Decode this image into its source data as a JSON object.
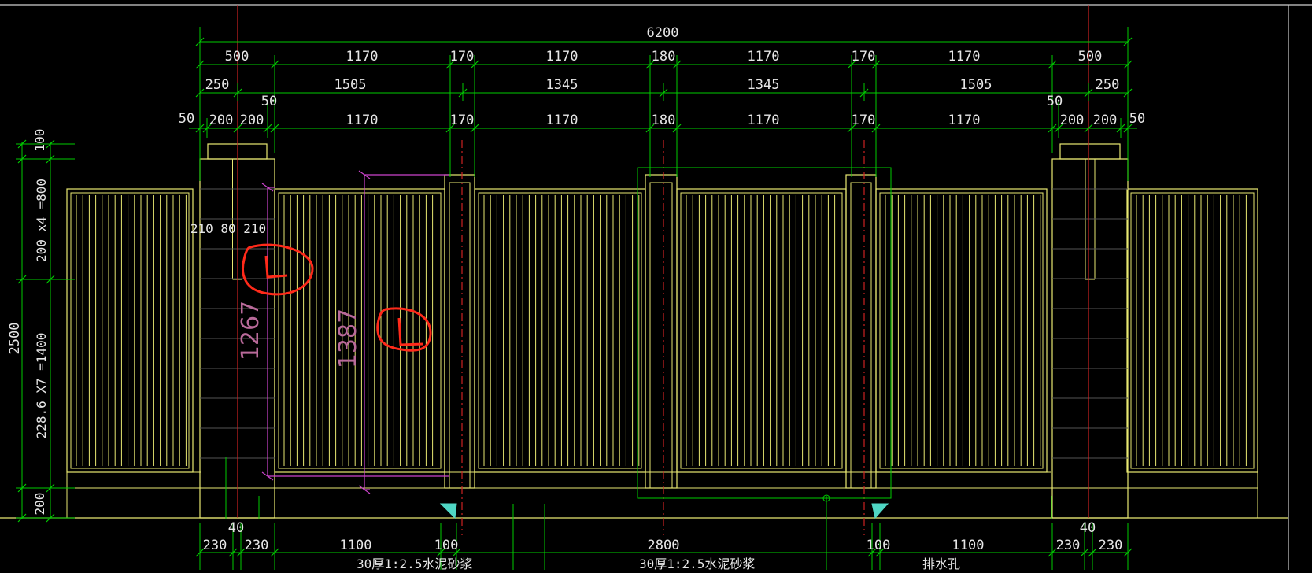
{
  "drawing": {
    "type": "cad-elevation",
    "colors": {
      "background": "#000000",
      "dimension_lines": "#00cc00",
      "geometry": "#e8e872",
      "centerline": "#cc2222",
      "annotation_magenta": "#cc44cc",
      "markup_red": "#ff2a1a",
      "text": "#e6e6e6",
      "frame": "#cfcfcf",
      "drain_marker": "#4fd6c4"
    }
  },
  "dimensions": {
    "overall": "6200",
    "row1": [
      "500",
      "1170",
      "170",
      "1170",
      "180",
      "1170",
      "170",
      "1170",
      "500"
    ],
    "row2": [
      "250",
      "1505",
      "1345",
      "1345",
      "1505",
      "250"
    ],
    "row3_left": [
      "50",
      "50",
      "200",
      "200"
    ],
    "row3_mid": [
      "1170",
      "170",
      "1170",
      "180",
      "1170",
      "170",
      "1170"
    ],
    "row3_right": [
      "50",
      "200",
      "200",
      "50"
    ],
    "pier_detail": "210 80 210",
    "vertical_left": {
      "top": "100",
      "upper": "200 x4 =800",
      "total": "2500",
      "lower": "228.6 X7 =1400",
      "base": "200"
    },
    "bottom_row": {
      "left_gap": "40",
      "right_gap": "40",
      "values": [
        "230",
        "230",
        "1100",
        "100",
        "2800",
        "100",
        "1100",
        "230",
        "230"
      ]
    },
    "magenta": {
      "inner": "1267",
      "outer": "1387"
    }
  },
  "notes": {
    "mortar_left": "30厚1:2.5水泥砂浆",
    "mortar_center": "30厚1:2.5水泥砂浆",
    "drain_hole": "排水孔"
  },
  "markups": {
    "circle_1_glyph": "",
    "circle_2_glyph": ""
  }
}
